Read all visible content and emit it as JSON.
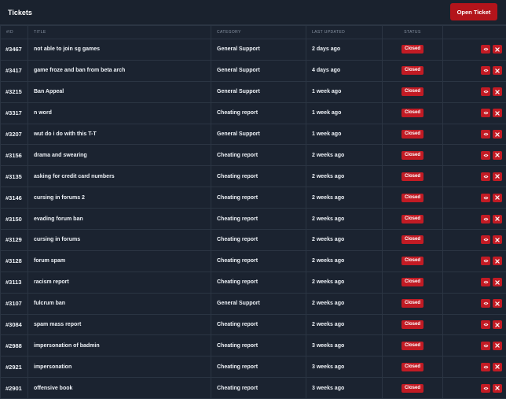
{
  "header": {
    "title": "Tickets",
    "open_ticket_label": "Open Ticket"
  },
  "columns": {
    "id": "#ID",
    "title": "TITLE",
    "category": "CATEGORY",
    "last_updated": "LAST UPDATED",
    "status": "STATUS"
  },
  "colors": {
    "accent": "#c21b24",
    "background": "#1b2330",
    "border": "#2b3543"
  },
  "icons": {
    "view": "eye-icon",
    "close": "close-icon"
  },
  "tickets": [
    {
      "id": "#3467",
      "title": "not able to join sg games",
      "category": "General Support",
      "updated": "2 days ago",
      "status": "Closed"
    },
    {
      "id": "#3417",
      "title": "game froze and ban from beta arch",
      "category": "General Support",
      "updated": "4 days ago",
      "status": "Closed"
    },
    {
      "id": "#3215",
      "title": "Ban Appeal",
      "category": "General Support",
      "updated": "1 week ago",
      "status": "Closed"
    },
    {
      "id": "#3317",
      "title": "n word",
      "category": "Cheating report",
      "updated": "1 week ago",
      "status": "Closed"
    },
    {
      "id": "#3207",
      "title": "wut do i do with this T-T",
      "category": "General Support",
      "updated": "1 week ago",
      "status": "Closed"
    },
    {
      "id": "#3156",
      "title": "drama and swearing",
      "category": "Cheating report",
      "updated": "2 weeks ago",
      "status": "Closed"
    },
    {
      "id": "#3135",
      "title": "asking for credit card numbers",
      "category": "Cheating report",
      "updated": "2 weeks ago",
      "status": "Closed"
    },
    {
      "id": "#3146",
      "title": "cursing in forums 2",
      "category": "Cheating report",
      "updated": "2 weeks ago",
      "status": "Closed"
    },
    {
      "id": "#3150",
      "title": "evading forum ban",
      "category": "Cheating report",
      "updated": "2 weeks ago",
      "status": "Closed"
    },
    {
      "id": "#3129",
      "title": "cursing in forums",
      "category": "Cheating report",
      "updated": "2 weeks ago",
      "status": "Closed"
    },
    {
      "id": "#3128",
      "title": "forum spam",
      "category": "Cheating report",
      "updated": "2 weeks ago",
      "status": "Closed"
    },
    {
      "id": "#3113",
      "title": "racism report",
      "category": "Cheating report",
      "updated": "2 weeks ago",
      "status": "Closed"
    },
    {
      "id": "#3107",
      "title": "fulcrum ban",
      "category": "General Support",
      "updated": "2 weeks ago",
      "status": "Closed"
    },
    {
      "id": "#3084",
      "title": "spam mass report",
      "category": "Cheating report",
      "updated": "2 weeks ago",
      "status": "Closed"
    },
    {
      "id": "#2988",
      "title": "impersonation of badmin",
      "category": "Cheating report",
      "updated": "3 weeks ago",
      "status": "Closed"
    },
    {
      "id": "#2921",
      "title": "impersonation",
      "category": "Cheating report",
      "updated": "3 weeks ago",
      "status": "Closed"
    },
    {
      "id": "#2901",
      "title": "offensive book",
      "category": "Cheating report",
      "updated": "3 weeks ago",
      "status": "Closed"
    }
  ]
}
